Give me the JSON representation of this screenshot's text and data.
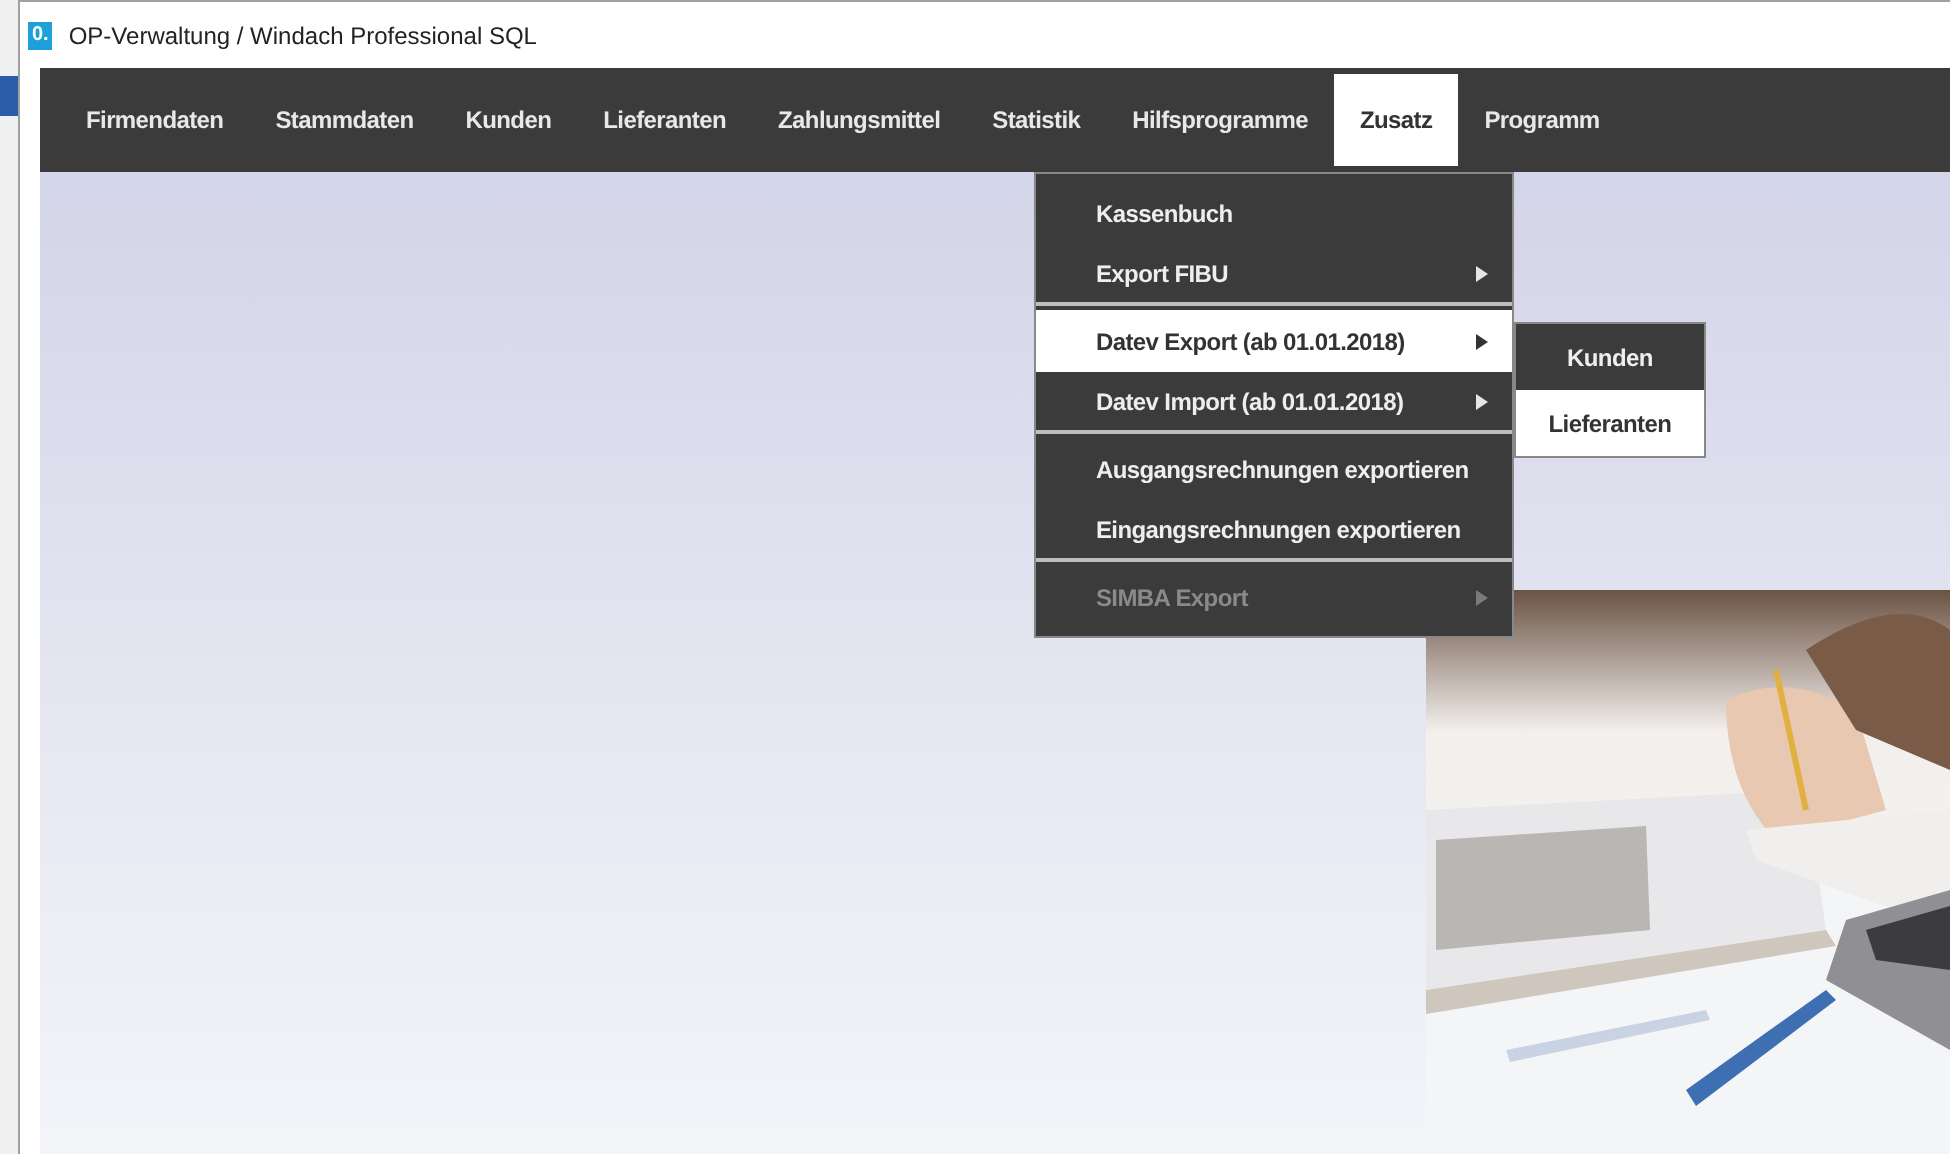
{
  "window": {
    "title": "OP-Verwaltung / Windach Professional SQL",
    "app_icon": "0."
  },
  "menubar": [
    {
      "label": "Firmendaten",
      "selected": false
    },
    {
      "label": "Stammdaten",
      "selected": false
    },
    {
      "label": "Kunden",
      "selected": false
    },
    {
      "label": "Lieferanten",
      "selected": false
    },
    {
      "label": "Zahlungsmittel",
      "selected": false
    },
    {
      "label": "Statistik",
      "selected": false
    },
    {
      "label": "Hilfsprogramme",
      "selected": false
    },
    {
      "label": "Zusatz",
      "selected": true
    },
    {
      "label": "Programm",
      "selected": false
    }
  ],
  "dropdown": [
    {
      "label": "Kassenbuch",
      "selected": false,
      "disabled": false,
      "submenu": false,
      "separator_after": false
    },
    {
      "label": "Export FIBU",
      "selected": false,
      "disabled": false,
      "submenu": true,
      "separator_after": true
    },
    {
      "label": "Datev Export (ab 01.01.2018)",
      "selected": true,
      "disabled": false,
      "submenu": true,
      "separator_after": false
    },
    {
      "label": "Datev Import (ab 01.01.2018)",
      "selected": false,
      "disabled": false,
      "submenu": true,
      "separator_after": true
    },
    {
      "label": "Ausgangsrechnungen exportieren",
      "selected": false,
      "disabled": false,
      "submenu": false,
      "separator_after": false
    },
    {
      "label": "Eingangsrechnungen exportieren",
      "selected": false,
      "disabled": false,
      "submenu": false,
      "separator_after": true
    },
    {
      "label": "SIMBA Export",
      "selected": false,
      "disabled": true,
      "submenu": true,
      "separator_after": false
    }
  ],
  "submenu": [
    {
      "label": "Kunden",
      "selected": false
    },
    {
      "label": "Lieferanten",
      "selected": true
    }
  ]
}
